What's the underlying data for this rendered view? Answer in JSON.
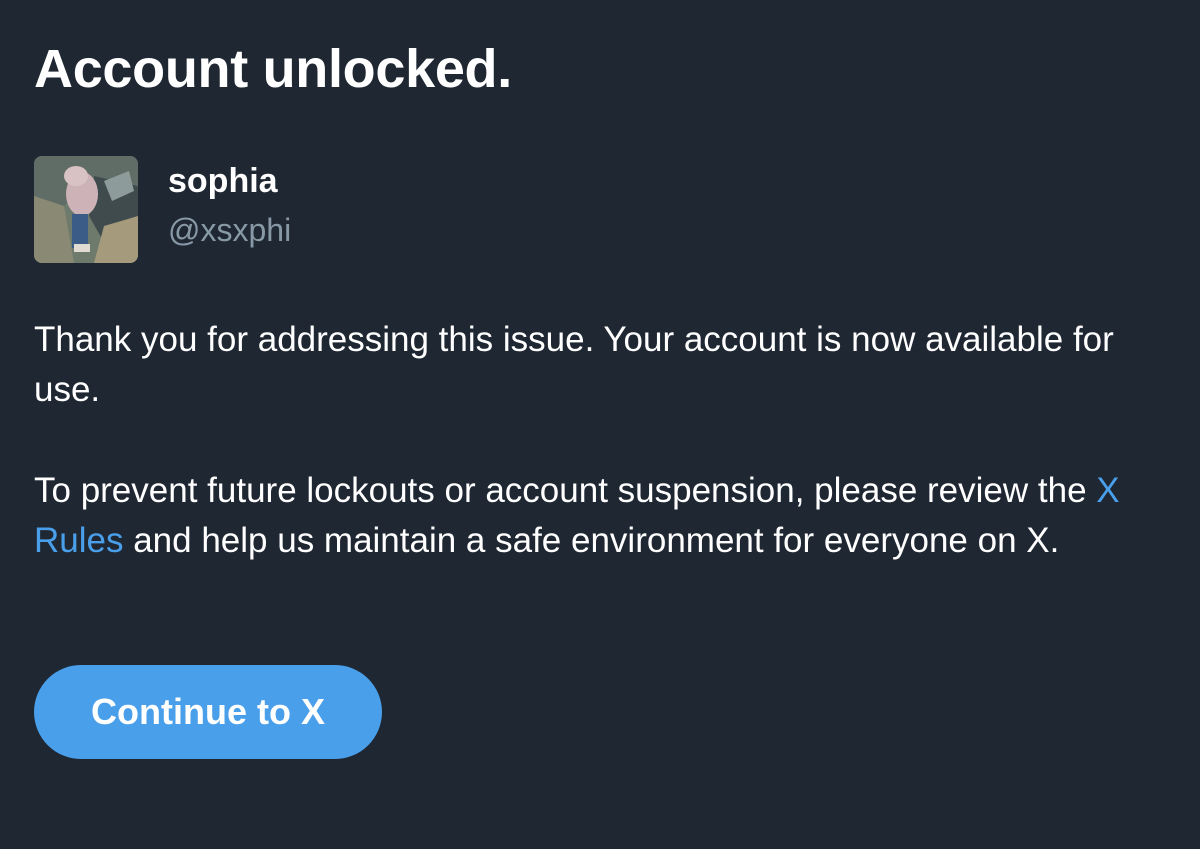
{
  "header": {
    "title": "Account unlocked."
  },
  "profile": {
    "display_name": "sophia",
    "handle": "@xsxphi"
  },
  "message": {
    "paragraph_1": "Thank you for addressing this issue. Your account is now available for use.",
    "paragraph_2_before_link": "To prevent future lockouts or account suspension, please review the ",
    "rules_link": "X Rules",
    "paragraph_2_after_link": " and help us maintain a safe environment for everyone on X."
  },
  "actions": {
    "continue_label": "Continue to X"
  },
  "colors": {
    "background": "#1f2733",
    "text": "#ffffff",
    "secondary_text": "#8899a6",
    "accent": "#4a9fea"
  }
}
